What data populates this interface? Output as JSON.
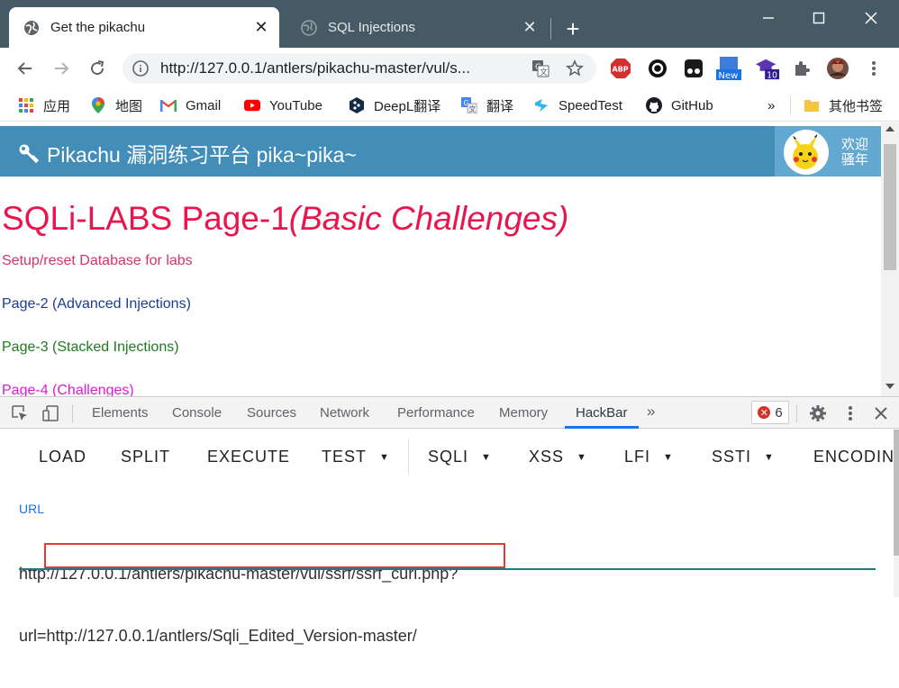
{
  "tabs": [
    {
      "title": "Get the pikachu",
      "active": true,
      "icon": "globe-icon"
    },
    {
      "title": "SQL Injections",
      "active": false,
      "icon": "globe-icon"
    }
  ],
  "omnibox": {
    "url": "http://127.0.0.1/antlers/pikachu-master/vul/s..."
  },
  "extensions": {
    "new_badge": "New",
    "count_badge": "10",
    "abp": "ABP"
  },
  "bookmarks": [
    {
      "label": "应用",
      "icon": "apps-grid-icon"
    },
    {
      "label": "地图",
      "icon": "maps-pin-icon"
    },
    {
      "label": "Gmail",
      "icon": "gmail-icon"
    },
    {
      "label": "YouTube",
      "icon": "youtube-icon"
    },
    {
      "label": "DeepL翻译",
      "icon": "deepl-icon"
    },
    {
      "label": "翻译",
      "icon": "translate-icon"
    },
    {
      "label": "SpeedTest",
      "icon": "speedtest-icon"
    },
    {
      "label": "GitHub",
      "icon": "github-icon"
    }
  ],
  "bookmarks_overflow": "»",
  "other_bookmarks": "其他书签",
  "page": {
    "header_title": "Pikachu 漏洞练习平台 pika~pika~",
    "welcome_line1": "欢迎",
    "welcome_line2": "骚年",
    "sqli_title_main": "SQLi-LABS Page-1",
    "sqli_title_sub": "(Basic Challenges)",
    "links": [
      {
        "text": "Setup/reset Database for labs",
        "color": "#d6336c"
      },
      {
        "text": "Page-2 (Advanced Injections)",
        "color": "#1a3d8f"
      },
      {
        "text": "Page-3 (Stacked Injections)",
        "color": "#1f7a1f"
      },
      {
        "text": "Page-4 (Challenges)",
        "color": "#e01ad6"
      }
    ]
  },
  "devtools": {
    "tabs": [
      "Elements",
      "Console",
      "Sources",
      "Network",
      "Performance",
      "Memory",
      "HackBar"
    ],
    "selected_tab": "HackBar",
    "more": "»",
    "error_count": "6"
  },
  "hackbar": {
    "buttons": [
      {
        "label": "LOAD",
        "dropdown": false
      },
      {
        "label": "SPLIT",
        "dropdown": false
      },
      {
        "label": "EXECUTE",
        "dropdown": false
      },
      {
        "label": "TEST",
        "dropdown": true
      },
      {
        "label": "SQLI",
        "dropdown": true
      },
      {
        "label": "XSS",
        "dropdown": true
      },
      {
        "label": "LFI",
        "dropdown": true
      },
      {
        "label": "SSTI",
        "dropdown": true
      },
      {
        "label": "ENCODING",
        "dropdown": false
      }
    ],
    "url_label": "URL",
    "url_line1": "http://127.0.0.1/antlers/pikachu-master/vul/ssrf/ssrf_curl.php?",
    "url_line2": "url=http://127.0.0.1/antlers/Sqli_Edited_Version-master/"
  },
  "colors": {
    "titlebar": "#455A64",
    "pikachu_header": "#438eb9",
    "sqli_title": "#e8164d",
    "accent": "#1a73e8",
    "highlight_box": "#e53935"
  }
}
